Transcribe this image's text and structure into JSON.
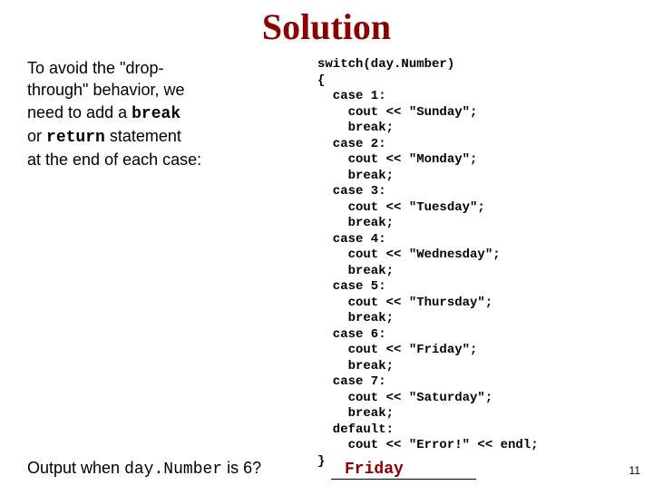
{
  "title": "Solution",
  "left": {
    "line1": "To avoid the \"drop-",
    "line2": "through\" behavior, we",
    "line3a": "need to add a ",
    "line3b": "break",
    "line4a": "or ",
    "line4b": "return",
    "line4c": " statement",
    "line5": "at the end of each case:"
  },
  "code": "switch(day.Number)\n{\n  case 1:\n    cout << \"Sunday\";\n    break;\n  case 2:\n    cout << \"Monday\";\n    break;\n  case 3:\n    cout << \"Tuesday\";\n    break;\n  case 4:\n    cout << \"Wednesday\";\n    break;\n  case 5:\n    cout << \"Thursday\";\n    break;\n  case 6:\n    cout << \"Friday\";\n    break;\n  case 7:\n    cout << \"Saturday\";\n    break;\n  default:\n    cout << \"Error!\" << endl;\n}",
  "footer": {
    "q1": "Output when ",
    "q2": "day.Number",
    "q3": " is 6? "
  },
  "answer": "Friday",
  "pagenum": "11"
}
